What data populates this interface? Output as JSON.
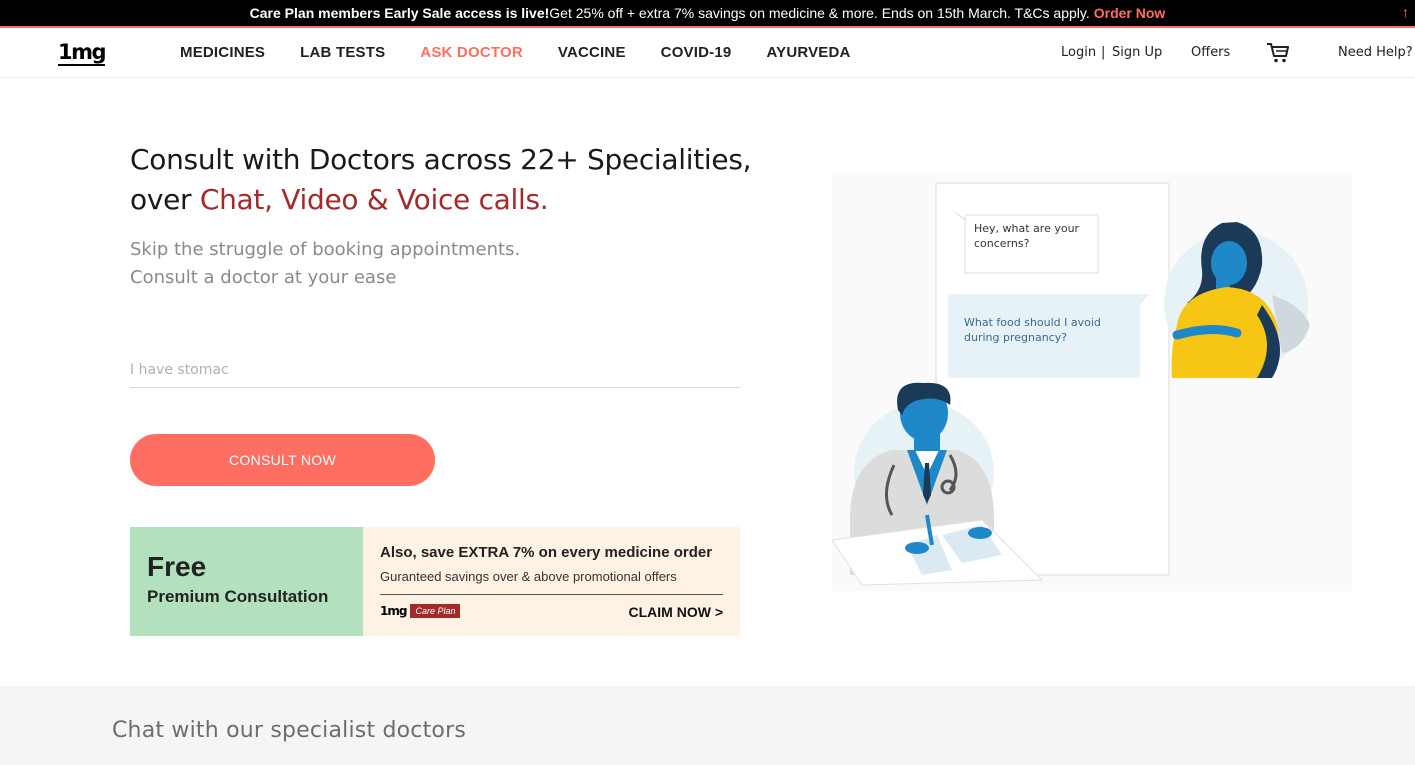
{
  "announcement": {
    "bold": "Care Plan members Early Sale access is live!",
    "text": " Get 25% off + extra 7% savings on medicine & more. Ends on 15th March. T&Cs apply.",
    "link": "Order Now",
    "up_glyph": "↑"
  },
  "nav": {
    "logo": "1mg",
    "items": [
      {
        "label": "MEDICINES"
      },
      {
        "label": "LAB TESTS"
      },
      {
        "label": "ASK DOCTOR",
        "active": true
      },
      {
        "label": "VACCINE"
      },
      {
        "label": "COVID-19"
      },
      {
        "label": "AYURVEDA"
      }
    ],
    "login": "Login",
    "sep": "|",
    "signup": "Sign Up",
    "offers": "Offers",
    "help": "Need Help?",
    "cart_icon": "cart-icon"
  },
  "hero": {
    "headline_line1": "Consult with Doctors across 22+ Specialities,",
    "headline_prefix": "over ",
    "headline_accent": "Chat, Video & Voice calls.",
    "sub_line1": "Skip the struggle of booking appointments.",
    "sub_line2": "Consult a doctor at your ease",
    "search_placeholder": "I have stomac",
    "cta": "CONSULT NOW"
  },
  "promo": {
    "free": "Free",
    "premium": "Premium Consultation",
    "headline": "Also, save EXTRA 7% on every medicine order",
    "sub": "Guranteed savings over & above promotional offers",
    "brand": "1mg",
    "care_plan": "Care Plan",
    "claim": "CLAIM NOW >"
  },
  "illustration": {
    "bubble_doctor": [
      "Hey, what are your",
      "concerns?"
    ],
    "bubble_patient": [
      "What food should I avoid",
      "during pregnancy?"
    ]
  },
  "section": {
    "title": "Chat with our specialist doctors"
  },
  "colors": {
    "accent": "#ff6f61",
    "headline_accent": "#a32a2a",
    "promo_green": "#b3e0bd",
    "promo_cream": "#fdf2e4"
  }
}
